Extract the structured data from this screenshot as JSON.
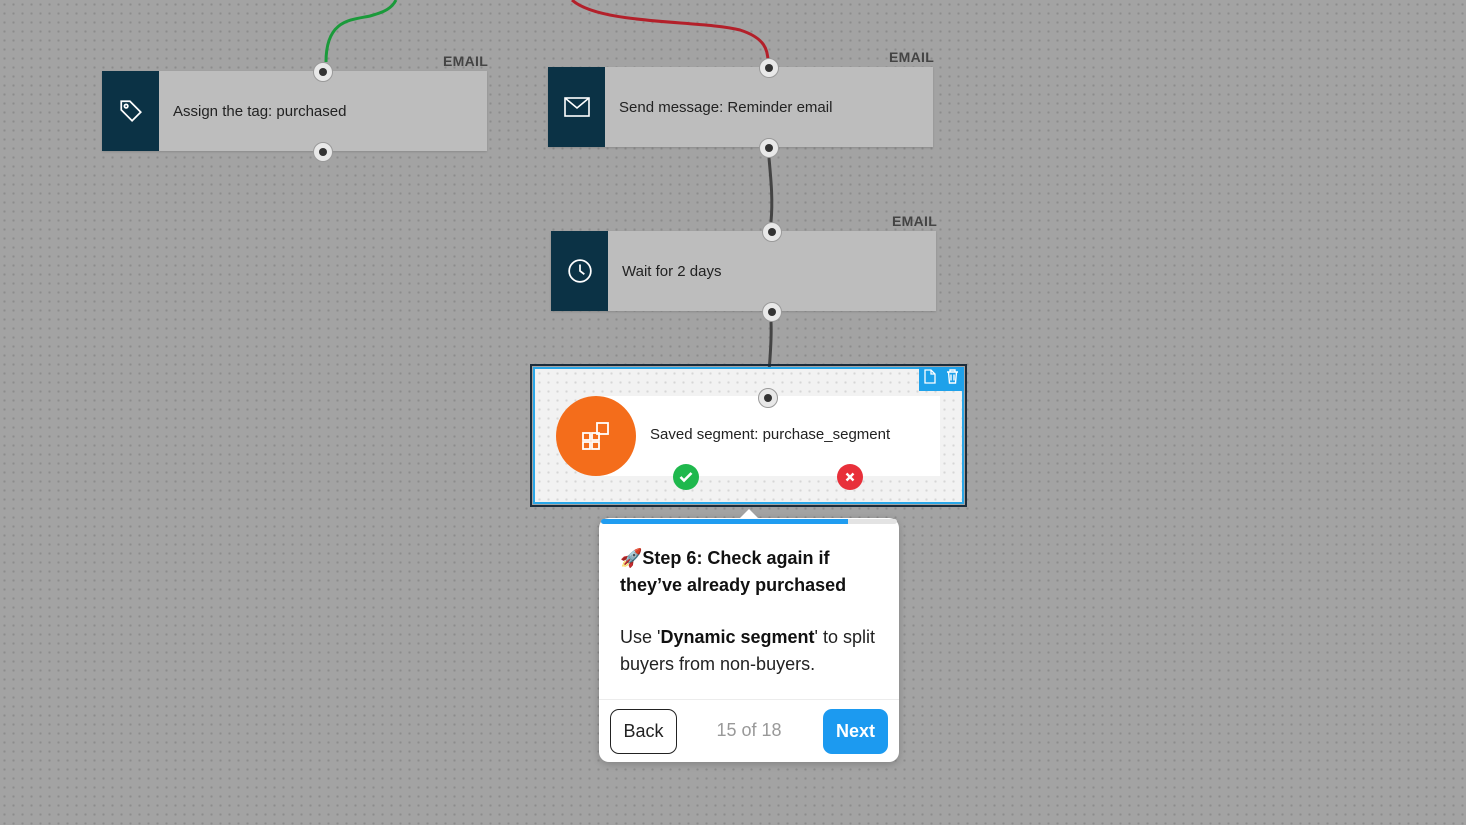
{
  "canvas": {
    "nodes": [
      {
        "id": "assign-tag",
        "label": "Assign the tag: purchased",
        "tag": "EMAIL",
        "icon": "tag-icon"
      },
      {
        "id": "send-message",
        "label": "Send message: Reminder email",
        "tag": "EMAIL",
        "icon": "envelope-icon"
      },
      {
        "id": "wait",
        "label": "Wait for 2 days",
        "tag": "EMAIL",
        "icon": "clock-icon"
      }
    ],
    "selected_node": {
      "label": "Saved segment: purchase_segment",
      "icon": "segment-icon",
      "toolbar": [
        "copy-icon",
        "trash-icon"
      ],
      "outputs": [
        "yes-check-icon",
        "no-x-icon"
      ]
    },
    "colors": {
      "node_icon_bg": "#0b3245",
      "segment_orange": "#f46d1b",
      "accent_blue": "#1c9af0",
      "wire_green": "#1a9a3a",
      "wire_red": "#b3202a",
      "yes_green": "#1fb84d",
      "no_red": "#e8303a"
    }
  },
  "tour": {
    "progress_fraction": 0.833,
    "emoji": "🚀",
    "title": "Step 6: Check again if they’ve already purchased",
    "body_prefix": "Use '",
    "body_bold": "Dynamic segment",
    "body_suffix": "' to split buyers from non-buyers.",
    "back_label": "Back",
    "step_counter": "15 of 18",
    "next_label": "Next"
  }
}
